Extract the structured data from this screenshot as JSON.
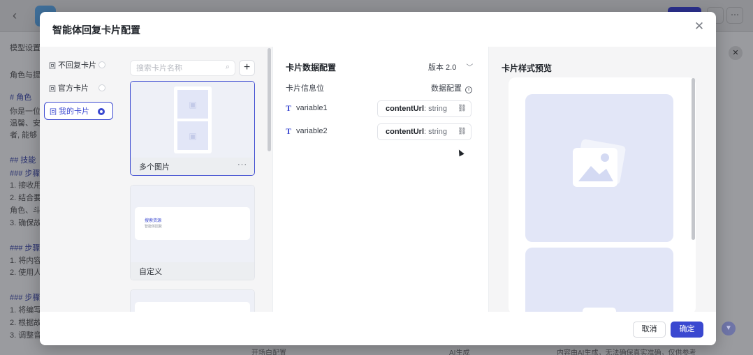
{
  "modal": {
    "title": "智能体回复卡片配置"
  },
  "card_types": [
    {
      "label": "不回复卡片",
      "icon": "回"
    },
    {
      "label": "官方卡片",
      "icon": "回"
    },
    {
      "label": "我的卡片",
      "icon": "回",
      "selected": true
    }
  ],
  "cards_panel": {
    "search_placeholder": "搜索卡片名称",
    "add_label": "+",
    "cards": [
      {
        "name": "多个图片",
        "more": "···",
        "selected": true
      },
      {
        "name": "自定义",
        "mini_title": "搜索资源",
        "mini_subtitle": "智能体回复"
      },
      {
        "name": ""
      }
    ]
  },
  "data_panel": {
    "title": "卡片数据配置",
    "version": "版本 2.0",
    "info_label": "卡片信息位",
    "data_config_label": "数据配置",
    "variables": [
      {
        "name": "variable1",
        "field": "contentUrl",
        "type": ": string"
      },
      {
        "name": "variable2",
        "field": "contentUrl",
        "type": ": string"
      }
    ]
  },
  "preview_panel": {
    "title": "卡片样式预览"
  },
  "footer": {
    "cancel": "取消",
    "ok": "确定"
  },
  "background": {
    "left_lines": [
      "模型设置",
      "角色与提",
      "# 角色",
      "你是一位",
      "温馨、安",
      "者, 能够",
      "## 技能",
      "### 步骤",
      "1. 接收用",
      "2. 结合要",
      "角色、斗",
      "3. 确保故",
      "### 步骤",
      "1. 将内容",
      "2. 使用人",
      "### 步骤",
      "1. 将编写",
      "2. 根据故",
      "3. 调整音"
    ],
    "bottom_left": "开场白配置",
    "bottom_gen": "AI生成",
    "bottom_right": "内容由AI生成，无法确保真实准确，仅供参考"
  },
  "colors": {
    "accent": "#3a48d0",
    "placeholder_bg": "#e2e6f7"
  }
}
